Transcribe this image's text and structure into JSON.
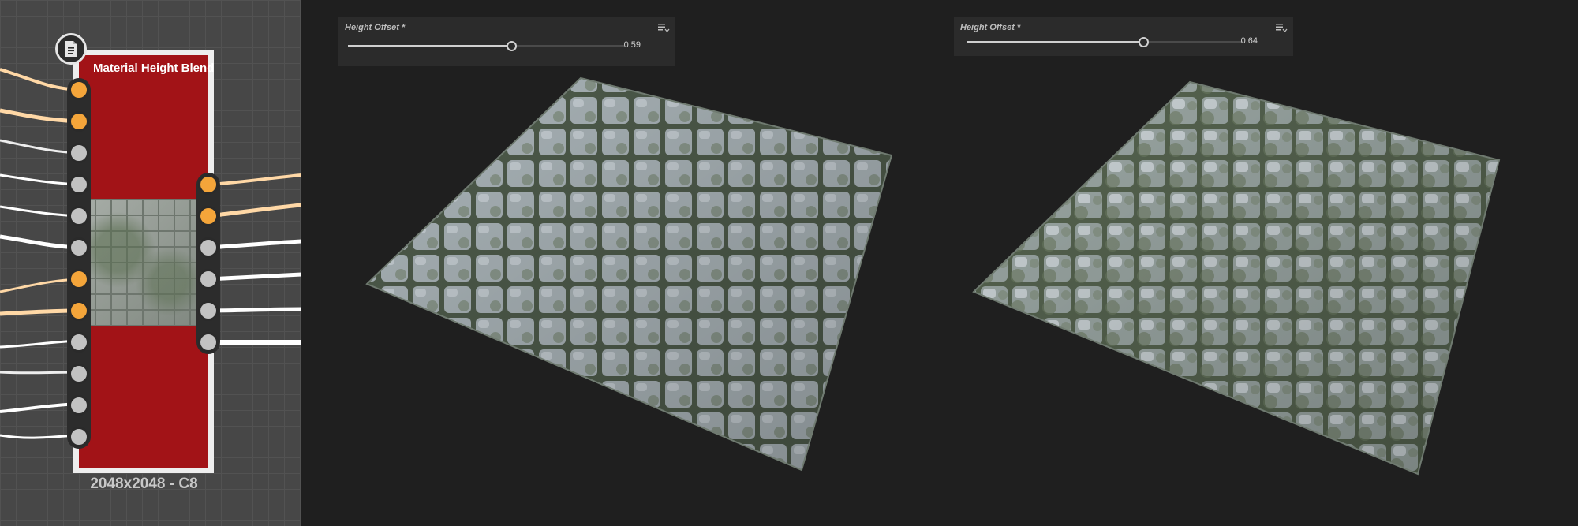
{
  "graph": {
    "node_title": "Material Height Blend",
    "node_resolution": "2048x2048 - C8",
    "node_icon": "document-icon",
    "colors": {
      "node": "#a21317",
      "port_active": "#f4a53a",
      "port_idle": "#c2c2c2"
    },
    "input_ports": [
      "active",
      "active",
      "idle",
      "idle",
      "idle",
      "idle",
      "active",
      "active",
      "idle",
      "idle",
      "idle",
      "idle"
    ],
    "output_ports": [
      "active",
      "active",
      "idle",
      "idle",
      "idle",
      "idle"
    ]
  },
  "left_panel": {
    "label": "Height Offset *",
    "value_text": "0.59",
    "value": 0.59,
    "menu_icon": "list-menu-icon"
  },
  "right_panel": {
    "label": "Height Offset *",
    "value_text": "0.64",
    "value": 0.64,
    "menu_icon": "list-menu-icon"
  }
}
